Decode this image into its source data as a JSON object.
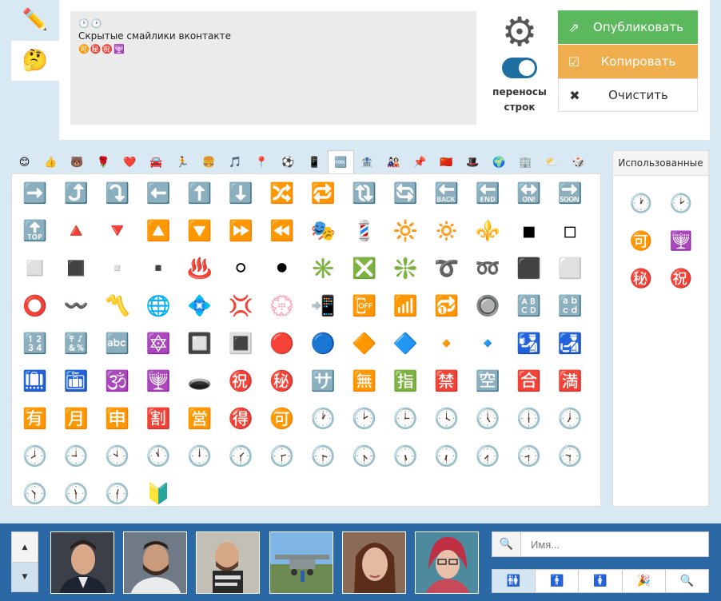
{
  "mode_tabs": [
    {
      "name": "edit",
      "glyph": "✏️"
    },
    {
      "name": "smileys",
      "glyph": "🤔"
    }
  ],
  "editor": {
    "icons_line": "🕐🕑",
    "text": "Скрытые смайлики вконтакте",
    "emoji_line": "🉑㊙️㊗️🕎"
  },
  "settings": {
    "gear": "⚙",
    "wrap_label_1": "переносы",
    "wrap_label_2": "строк",
    "wrap_on": true
  },
  "actions": {
    "publish": {
      "icon": "⇗",
      "label": "Опубликовать"
    },
    "copy": {
      "icon": "☑",
      "label": "Копировать"
    },
    "clear": {
      "icon": "✖",
      "label": "Очистить"
    }
  },
  "categories": [
    "😊",
    "👍",
    "🐻",
    "🌹",
    "❤️",
    "🚘",
    "🏃",
    "🍔",
    "🎵",
    "📍",
    "⚽",
    "📱",
    "🆒",
    "🏦",
    "🎎",
    "📌",
    "🇨🇳",
    "🎩",
    "🌍",
    "🏢",
    "⛅",
    "🎲"
  ],
  "active_category": 12,
  "emoji_grid": [
    "➡️",
    "⤴️",
    "⤵️",
    "⬅️",
    "⬆️",
    "⬇️",
    "🔀",
    "🔁",
    "🔃",
    "🔄",
    "🔙",
    "🔚",
    "🔛",
    "🔜",
    "🔝",
    "🔺",
    "🔻",
    "🔼",
    "🔽",
    "⏩",
    "⏪",
    "🎭",
    "💈",
    "🔆",
    "🔅",
    "⚜️",
    "◾",
    "◽",
    "◻️",
    "◼️",
    "▫️",
    "▪️",
    "♨️",
    "⚪",
    "⚫",
    "✳️",
    "❎",
    "❇️",
    "➰",
    "➿",
    "⬛",
    "⬜",
    "⭕",
    "〰️",
    "〽️",
    "🌐",
    "💠",
    "💢",
    "💮",
    "📲",
    "📴",
    "📶",
    "🔂",
    "🔘",
    "🔠",
    "🔡",
    "🔢",
    "🔣",
    "🔤",
    "🔯",
    "🔲",
    "🔳",
    "🔴",
    "🔵",
    "🔶",
    "🔷",
    "🔸",
    "🔹",
    "🛂",
    "🛃",
    "🛄",
    "🛅",
    "🕉️",
    "🕎",
    "🕳️",
    "㊗️",
    "㊙️",
    "🈂️",
    "🈚",
    "🈯",
    "🈲",
    "🈳",
    "🈴",
    "🈵",
    "🈶",
    "🈷️",
    "🈸",
    "🈹",
    "🈺",
    "🉐",
    "🉑",
    "🕐",
    "🕑",
    "🕒",
    "🕓",
    "🕔",
    "🕕",
    "🕖",
    "🕗",
    "🕘",
    "🕙",
    "🕚",
    "🕛",
    "🕜",
    "🕝",
    "🕞",
    "🕟",
    "🕠",
    "🕡",
    "🕢",
    "🕣",
    "🕤",
    "🕥",
    "🕦",
    "🕧",
    "🔰"
  ],
  "used": {
    "title": "Использованные",
    "items": [
      "🕐",
      "🕑",
      "🉑",
      "🕎",
      "㊙️",
      "㊗️"
    ]
  },
  "bottom": {
    "scroll_up": "▲",
    "scroll_down": "▼",
    "search_icon": "🔍",
    "search_placeholder": "Имя...",
    "filters": [
      "🚻",
      "🚹",
      "🚺",
      "🎉",
      "🔍"
    ],
    "active_filter": 0
  },
  "colors": {
    "publish": "#5cb85c",
    "copy": "#f0ad4e",
    "bottom_bar": "#2b68a6",
    "page_bg": "#d9e9f4"
  }
}
